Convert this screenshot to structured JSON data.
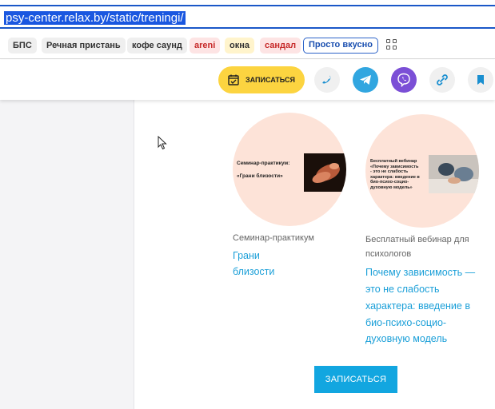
{
  "browser": {
    "url": "psy-center.relax.by/static/treningi/",
    "bookmarks": [
      {
        "label": "БПС",
        "style": "grey"
      },
      {
        "label": "Речная пристань",
        "style": "grey"
      },
      {
        "label": "кофе саунд",
        "style": "grey"
      },
      {
        "label": "areni",
        "style": "red"
      },
      {
        "label": "окна",
        "style": "yellow"
      },
      {
        "label": "сандал",
        "style": "red"
      },
      {
        "label": "Просто вкусно",
        "style": "blue"
      }
    ]
  },
  "header": {
    "signup_label": "ЗАПИСАТЬСЯ",
    "icons": [
      "phone-icon",
      "telegram-icon",
      "viber-icon",
      "link-icon",
      "bookmark-icon"
    ]
  },
  "cards": [
    {
      "poster_title_line1": "Семинар-практикум:",
      "poster_title_line2": "«Грани близости»",
      "type": "Семинар-практикум",
      "title_line1": "Грани",
      "title_line2": "близости"
    },
    {
      "poster_title_line1": "Бесплатный вебинар",
      "poster_title_line2": "«Почему зависимость",
      "poster_title_line3": "- это не слабость",
      "poster_title_line4": "характера: введение в",
      "poster_title_line5": "био-психо-социо-",
      "poster_title_line6": "духовную модель»",
      "type_line1": "Бесплатный вебинар для",
      "type_line2": "психологов",
      "title_line1": "Почему зависимость —",
      "title_line2": "это не слабость",
      "title_line3": "характера: введение в",
      "title_line4": "био-психо-социо-",
      "title_line5": "духовную модель"
    }
  ],
  "main": {
    "signup_label": "ЗАПИСАТЬСЯ"
  },
  "colors": {
    "accent_yellow": "#fcd440",
    "accent_blue": "#12a6e0",
    "link_blue": "#1a9fd8",
    "card_bg": "#fde3d8",
    "telegram": "#31a6e0",
    "viber": "#7b4fd6"
  }
}
